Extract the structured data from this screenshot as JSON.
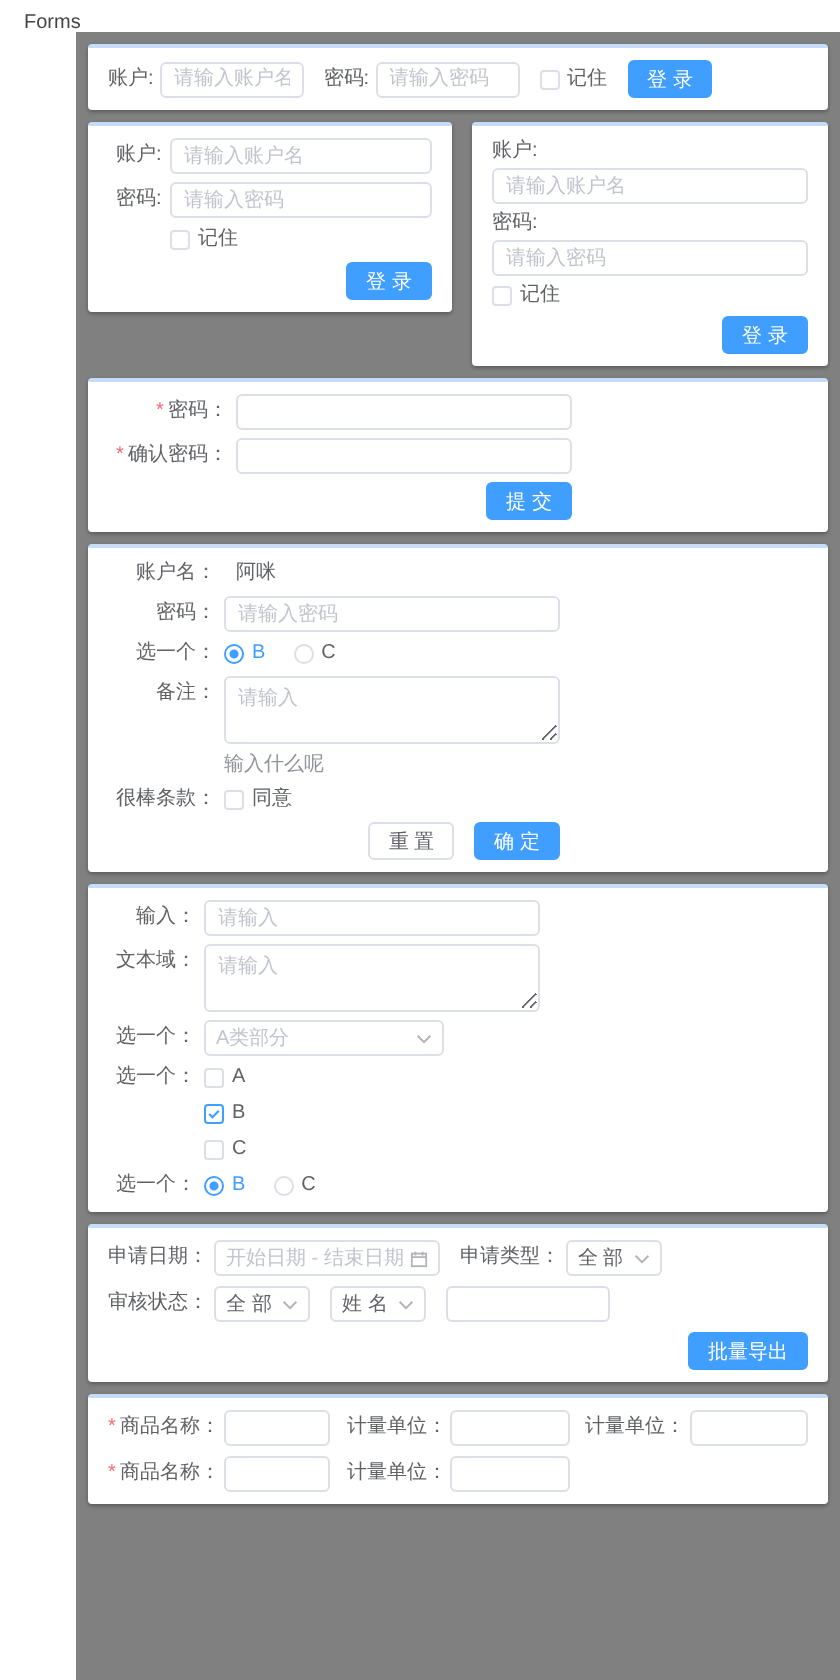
{
  "page": {
    "title": "Forms"
  },
  "rows": [
    [
      {
        "kind": "inline",
        "items": [
          {
            "kind": "input",
            "label": "账户:",
            "placeholder": "请输入账户名"
          },
          {
            "kind": "input",
            "label": "密码:",
            "placeholder": "请输入密码"
          },
          {
            "kind": "checkbox",
            "option": {
              "label": "记住",
              "checked": false
            }
          },
          {
            "kind": "buttons",
            "buttons": [
              {
                "label": "登 录",
                "kind": "primary"
              }
            ]
          }
        ]
      }
    ],
    [
      {
        "kind": "horizontal",
        "items": [
          {
            "kind": "input",
            "label": "账户:",
            "placeholder": "请输入账户名"
          },
          {
            "kind": "input",
            "label": "密码:",
            "placeholder": "请输入密码"
          },
          {
            "kind": "checkbox",
            "option": {
              "label": "记住",
              "checked": false
            }
          },
          {
            "kind": "buttons",
            "buttons": [
              {
                "label": "登 录",
                "kind": "primary"
              }
            ]
          }
        ]
      },
      {
        "kind": "vertical",
        "items": [
          {
            "kind": "input",
            "label": "账户:",
            "placeholder": "请输入账户名"
          },
          {
            "kind": "input",
            "label": "密码:",
            "placeholder": "请输入密码"
          },
          {
            "kind": "checkbox",
            "option": {
              "label": "记住",
              "checked": false
            }
          },
          {
            "kind": "buttons",
            "buttons": [
              {
                "label": "登 录",
                "kind": "primary"
              }
            ]
          }
        ]
      }
    ],
    [
      {
        "kind": "horizontal",
        "items": [
          {
            "kind": "input",
            "mark": "*",
            "label": "密码："
          },
          {
            "kind": "input",
            "mark": "*",
            "label": "确认密码："
          },
          {
            "kind": "buttons",
            "buttons": [
              {
                "label": "提 交",
                "kind": "primary"
              }
            ]
          }
        ]
      }
    ],
    [
      {
        "kind": "horizontal",
        "items": [
          {
            "kind": "text",
            "label": "账户名：",
            "value": "阿咪"
          },
          {
            "kind": "input",
            "label": "密码：",
            "placeholder": "请输入密码"
          },
          {
            "kind": "radio",
            "label": "选一个：",
            "options": [
              {
                "label": "B",
                "selected": true
              },
              {
                "label": "C",
                "selected": false
              }
            ]
          },
          {
            "kind": "textarea",
            "label": "备注：",
            "placeholder": "请输入",
            "help": "输入什么呢"
          },
          {
            "kind": "checkbox",
            "label": "很棒条款：",
            "option": {
              "label": "同意",
              "checked": false
            }
          },
          {
            "kind": "buttons",
            "buttons": [
              {
                "label": "重 置",
                "kind": "default"
              },
              {
                "label": "确 定",
                "kind": "primary"
              }
            ]
          }
        ]
      }
    ],
    [
      {
        "kind": "horizontal",
        "items": [
          {
            "kind": "input",
            "label": "输入：",
            "placeholder": "请输入"
          },
          {
            "kind": "textarea",
            "label": "文本域：",
            "placeholder": "请输入"
          },
          {
            "kind": "select",
            "label": "选一个：",
            "placeholder": "A类部分"
          },
          {
            "kind": "checkgroup",
            "label": "选一个：",
            "options": [
              {
                "label": "A",
                "checked": false
              },
              {
                "label": "B",
                "checked": true
              },
              {
                "label": "C",
                "checked": false
              }
            ]
          },
          {
            "kind": "radio",
            "label": "选一个：",
            "options": [
              {
                "label": "B",
                "selected": true
              },
              {
                "label": "C",
                "selected": false
              }
            ]
          }
        ]
      }
    ],
    [
      {
        "kind": "filter",
        "items": [
          {
            "kind": "daterange",
            "label": "申请日期：",
            "placeholder": "开始日期 - 结束日期"
          },
          {
            "kind": "select",
            "label": "申请类型：",
            "value": "全 部"
          },
          {
            "kind": "select",
            "label": "审核状态：",
            "value": "全 部"
          },
          {
            "kind": "select",
            "value": "姓 名"
          },
          {
            "kind": "input"
          },
          {
            "kind": "buttons",
            "buttons": [
              {
                "label": "批量导出",
                "kind": "primary"
              }
            ]
          }
        ]
      }
    ],
    [
      {
        "kind": "grid",
        "items": [
          {
            "kind": "input",
            "mark": "*",
            "label": "商品名称："
          },
          {
            "kind": "input",
            "label": "计量单位："
          },
          {
            "kind": "input",
            "label": "计量单位："
          },
          {
            "kind": "input",
            "mark": "*",
            "label": "商品名称："
          },
          {
            "kind": "input",
            "label": "计量单位："
          }
        ]
      }
    ]
  ]
}
